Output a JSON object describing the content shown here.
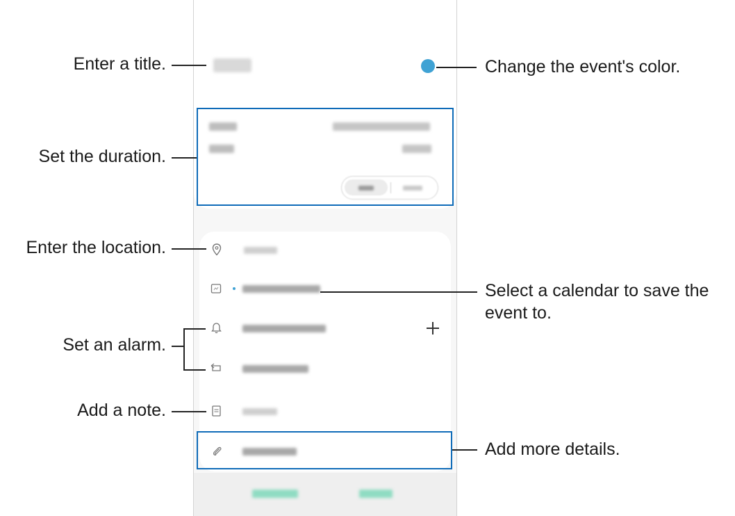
{
  "callouts": {
    "title": "Enter a title.",
    "color": "Change the event's color.",
    "duration": "Set the duration.",
    "location": "Enter the location.",
    "calendar_line1": "Select a calendar to save the",
    "calendar_line2": "event to.",
    "alarm": "Set an alarm.",
    "note": "Add a note.",
    "details": "Add more details."
  },
  "colors": {
    "event_color_dot": "#3fa2d4",
    "highlight_border": "#0e6bb8",
    "screen_bg": "#f7f7f7",
    "accent_text": "#7fd3b8"
  },
  "icons": [
    "location-pin-icon",
    "calendar-icon",
    "bell-icon",
    "repeat-icon",
    "memo-icon",
    "paperclip-icon",
    "plus-icon"
  ]
}
